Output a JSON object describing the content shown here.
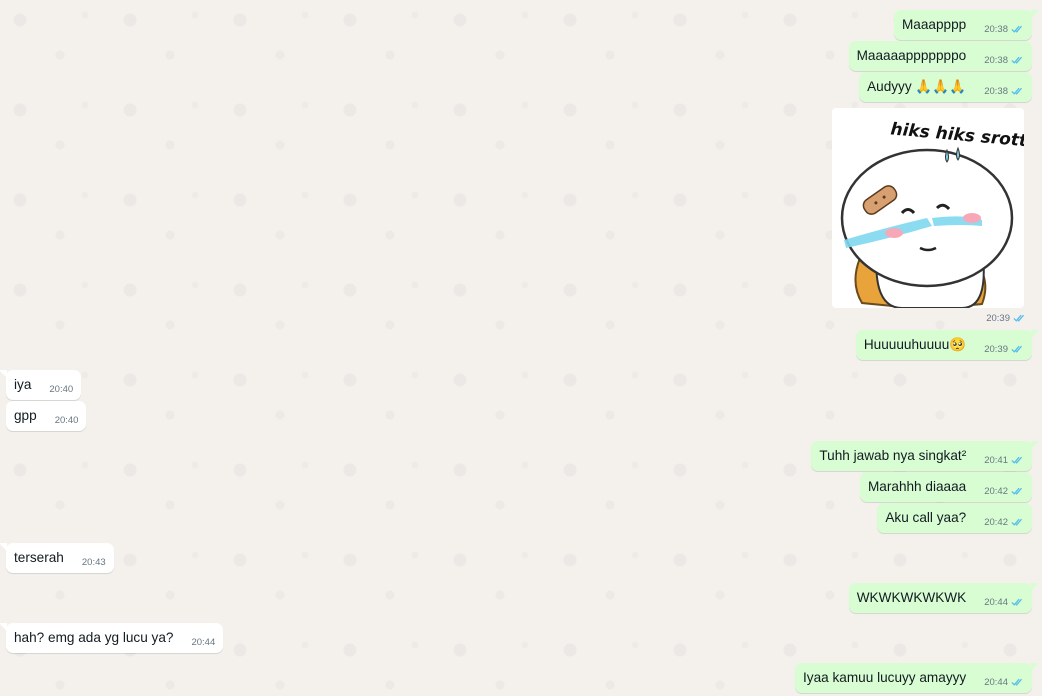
{
  "colors": {
    "outgoing_bubble": "#d9fdd3",
    "incoming_bubble": "#ffffff",
    "read_ticks": "#53bdeb",
    "timestamp": "#667781",
    "wallpaper": "#f4f1ed"
  },
  "icons": {
    "read_receipt": "double-check-icon"
  },
  "messages": [
    {
      "direction": "out",
      "text": "Maaapppp",
      "time": "20:38",
      "read": true
    },
    {
      "direction": "out",
      "text": "Maaaaapppppppo",
      "time": "20:38",
      "read": true
    },
    {
      "direction": "out",
      "text": "Audyyy 🙏🙏🙏",
      "time": "20:38",
      "read": true
    },
    {
      "direction": "out",
      "type": "sticker",
      "sticker_text": "hiks hiks srott..",
      "time": "20:39",
      "read": true
    },
    {
      "direction": "out",
      "text": "Huuuuuhuuuu🥺",
      "time": "20:39",
      "read": true
    },
    {
      "direction": "in",
      "text": "iya",
      "time": "20:40"
    },
    {
      "direction": "in",
      "text": "gpp",
      "time": "20:40"
    },
    {
      "direction": "out",
      "text": "Tuhh jawab nya singkat²",
      "time": "20:41",
      "read": true
    },
    {
      "direction": "out",
      "text": "Marahhh diaaaa",
      "time": "20:42",
      "read": true
    },
    {
      "direction": "out",
      "text": "Aku call yaa?",
      "time": "20:42",
      "read": true
    },
    {
      "direction": "in",
      "text": "terserah",
      "time": "20:43"
    },
    {
      "direction": "out",
      "text": "WKWKWKWKWK",
      "time": "20:44",
      "read": true
    },
    {
      "direction": "in",
      "text": "hah? emg ada yg lucu ya?",
      "time": "20:44"
    },
    {
      "direction": "out",
      "text": "Iyaa kamuu lucuyy amayyy",
      "time": "20:44",
      "read": true
    }
  ]
}
